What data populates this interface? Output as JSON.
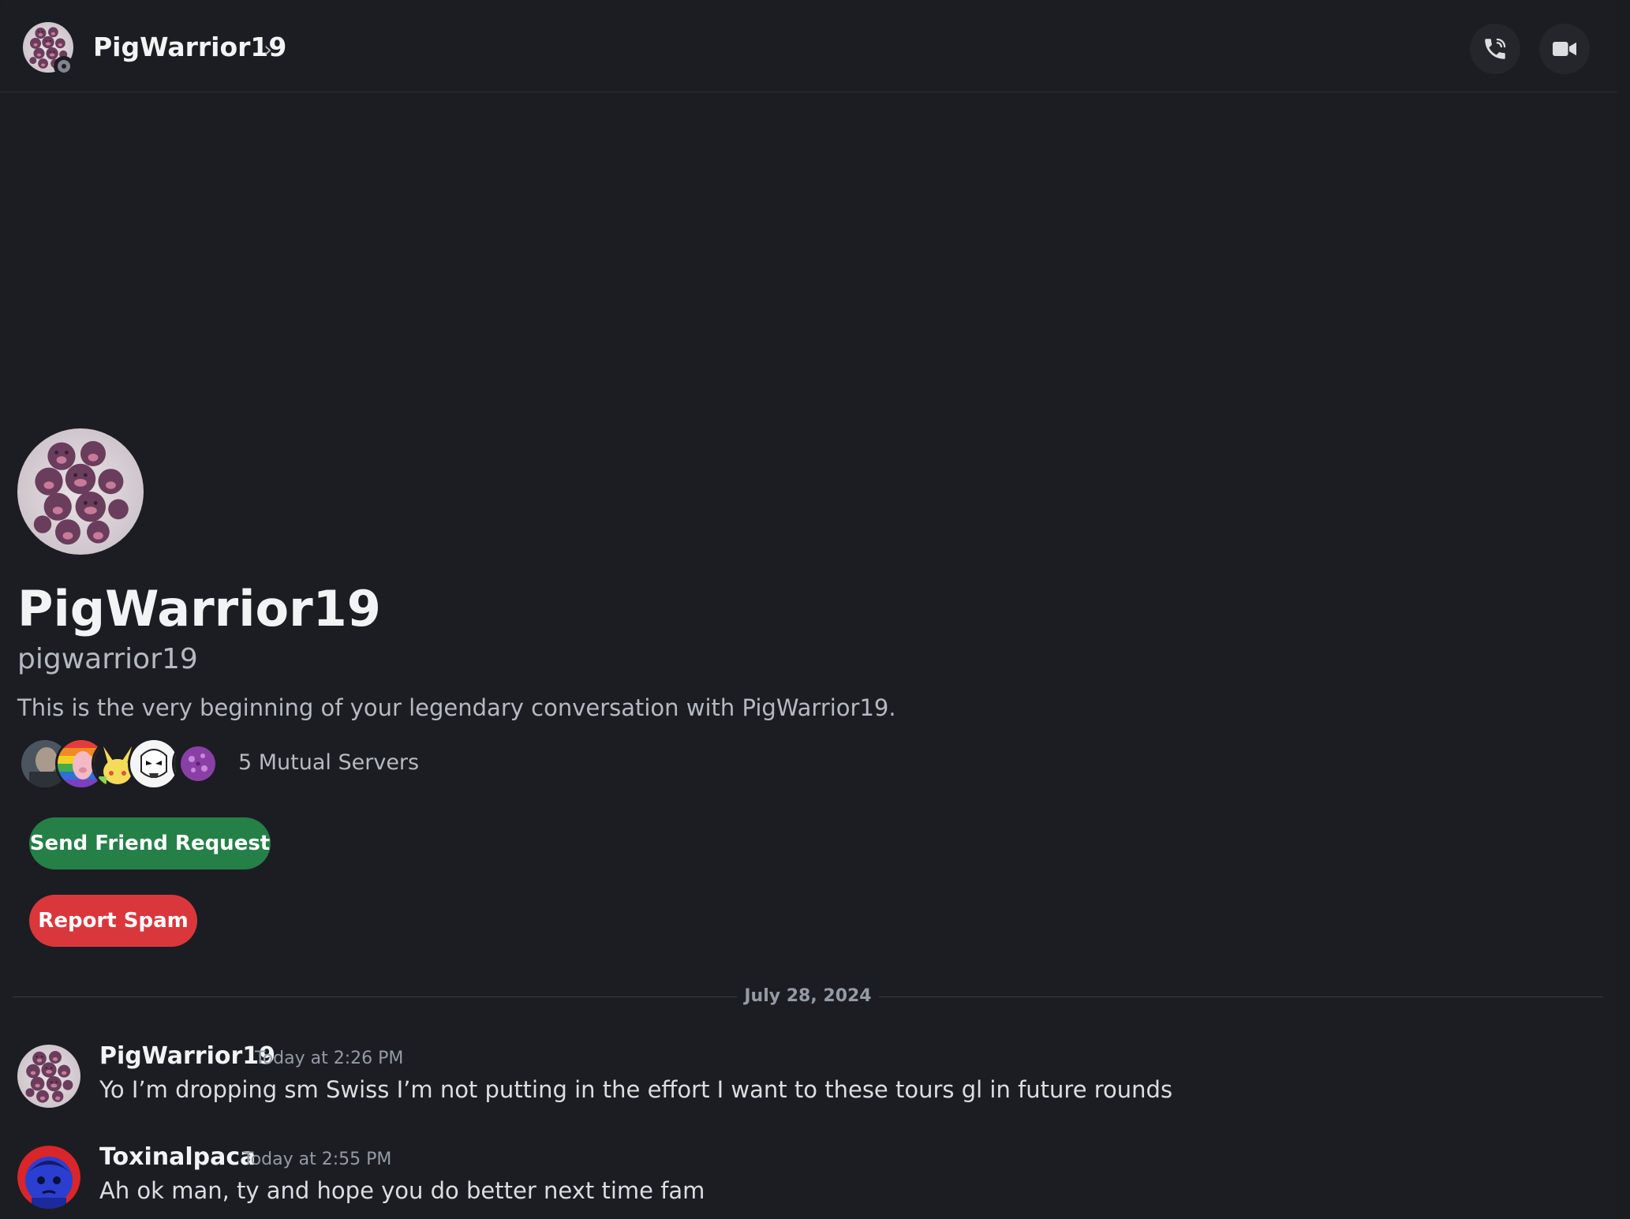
{
  "header": {
    "contact_name": "PigWarrior19",
    "status": "offline",
    "chevron_icon": "chevron-right-icon",
    "actions": [
      {
        "name": "voice-call",
        "icon": "phone-call-icon"
      },
      {
        "name": "video-call",
        "icon": "video-camera-icon"
      }
    ]
  },
  "profile": {
    "display_name": "PigWarrior19",
    "username": "pigwarrior19",
    "intro": "This is the very beginning of your legendary conversation with PigWarrior19.",
    "mutual_servers_label": "5 Mutual Servers",
    "mutual_server_icons": [
      "server-icon-portrait",
      "server-icon-pride-pig",
      "server-icon-pikachu",
      "server-icon-stormtrooper",
      "server-icon-purple-creature"
    ],
    "send_friend_request_label": "Send Friend Request",
    "report_spam_label": "Report Spam"
  },
  "divider": {
    "date": "July 28, 2024"
  },
  "messages": [
    {
      "author": "PigWarrior19",
      "timestamp": "Today at 2:26 PM",
      "text": "Yo I’m dropping sm Swiss I’m not putting in the effort I want to these tours gl in future rounds"
    },
    {
      "author": "Toxinalpaca",
      "timestamp": "Today at 2:55 PM",
      "text": "Ah ok man, ty and hope you do better next time fam"
    }
  ],
  "colors": {
    "background": "#1c1d22",
    "friend_button": "#248046",
    "spam_button": "#da373c",
    "muted_text": "#b5bac1"
  }
}
